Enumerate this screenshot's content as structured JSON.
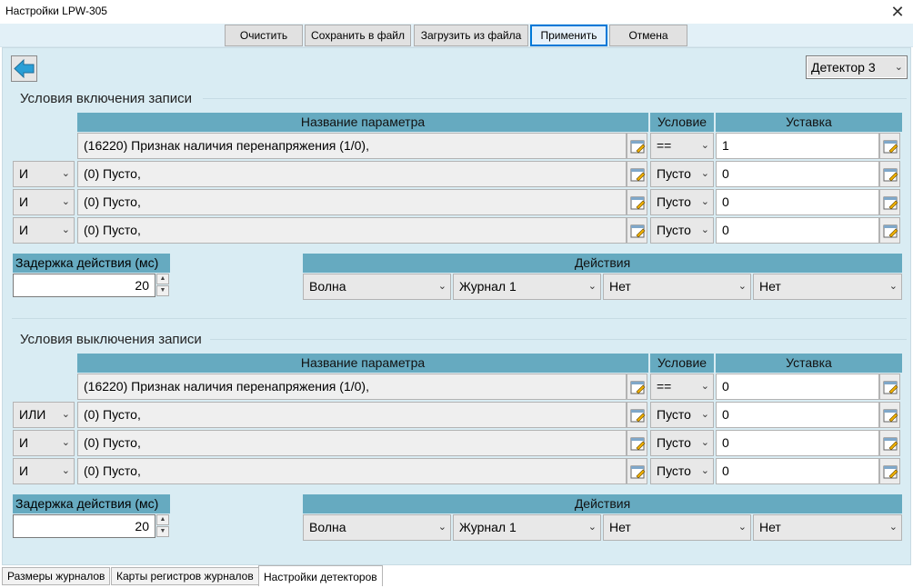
{
  "window": {
    "title": "Настройки LPW-305",
    "close_glyph": "✕"
  },
  "toolbar": {
    "clear": "Очистить",
    "save_file": "Сохранить в файл",
    "load_file": "Загрузить из файла",
    "apply": "Применить",
    "cancel": "Отмена"
  },
  "detector": {
    "selected": "Детектор 3"
  },
  "headers": {
    "param_name": "Название параметра",
    "condition": "Условие",
    "setpoint": "Уставка",
    "delay": "Задержка действия (мс)",
    "actions": "Действия"
  },
  "enable": {
    "title": "Условия включения записи",
    "rows": [
      {
        "logic": "",
        "param": "(16220) Признак наличия перенапряжения (1/0),",
        "cond": "==",
        "value": "1"
      },
      {
        "logic": "И",
        "param": "(0) Пусто,",
        "cond": "Пусто",
        "value": "0"
      },
      {
        "logic": "И",
        "param": "(0) Пусто,",
        "cond": "Пусто",
        "value": "0"
      },
      {
        "logic": "И",
        "param": "(0) Пусто,",
        "cond": "Пусто",
        "value": "0"
      }
    ],
    "delay_value": "20",
    "actions": [
      "Волна",
      "Журнал 1",
      "Нет",
      "Нет"
    ]
  },
  "disable": {
    "title": "Условия выключения записи",
    "rows": [
      {
        "logic": "",
        "param": "(16220) Признак наличия перенапряжения (1/0),",
        "cond": "==",
        "value": "0"
      },
      {
        "logic": "ИЛИ",
        "param": "(0) Пусто,",
        "cond": "Пусто",
        "value": "0"
      },
      {
        "logic": "И",
        "param": "(0) Пусто,",
        "cond": "Пусто",
        "value": "0"
      },
      {
        "logic": "И",
        "param": "(0) Пусто,",
        "cond": "Пусто",
        "value": "0"
      }
    ],
    "delay_value": "20",
    "actions": [
      "Волна",
      "Журнал 1",
      "Нет",
      "Нет"
    ]
  },
  "tabs": [
    "Размеры журналов",
    "Карты регистров журналов",
    "Настройки детекторов"
  ],
  "icons": {
    "back": "arrow-left-icon",
    "edit": "edit-icon",
    "dropdown": "chevron-down-icon"
  },
  "colors": {
    "header": "#66aac0",
    "panel": "#d9ecf3",
    "toolbar": "#e2f0f7",
    "back_arrow": "#2a9fd6"
  }
}
